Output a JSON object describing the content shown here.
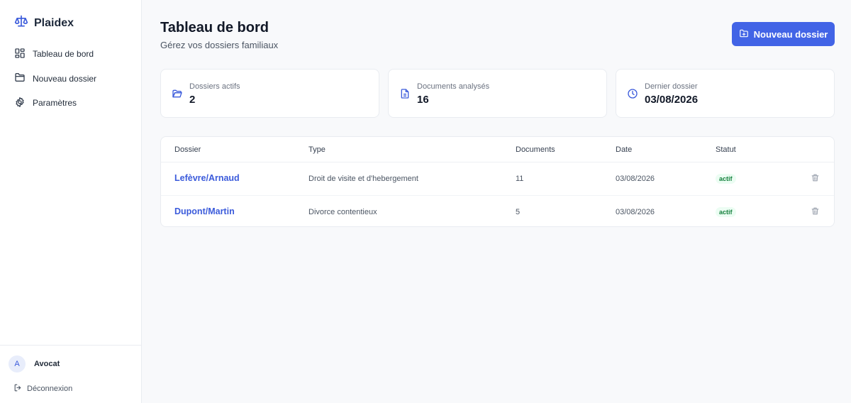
{
  "app": {
    "name": "Plaidex"
  },
  "sidebar": {
    "items": [
      {
        "label": "Tableau de bord",
        "icon": "dashboard-icon"
      },
      {
        "label": "Nouveau dossier",
        "icon": "folder-icon"
      },
      {
        "label": "Paramètres",
        "icon": "gear-icon"
      }
    ],
    "user": {
      "initial": "A",
      "name": "Avocat"
    },
    "logout_label": "Déconnexion"
  },
  "header": {
    "title": "Tableau de bord",
    "subtitle": "Gérez vos dossiers familiaux",
    "new_button_label": "Nouveau dossier"
  },
  "stats": [
    {
      "label": "Dossiers actifs",
      "value": "2",
      "icon": "folder-open-icon"
    },
    {
      "label": "Documents analysés",
      "value": "16",
      "icon": "document-icon"
    },
    {
      "label": "Dernier dossier",
      "value": "03/08/2026",
      "icon": "clock-icon"
    }
  ],
  "table": {
    "columns": [
      "Dossier",
      "Type",
      "Documents",
      "Date",
      "Statut"
    ],
    "rows": [
      {
        "dossier": "Lefèvre/Arnaud",
        "type": "Droit de visite et d'hebergement",
        "documents": "11",
        "date": "03/08/2026",
        "statut": "actif"
      },
      {
        "dossier": "Dupont/Martin",
        "type": "Divorce contentieux",
        "documents": "5",
        "date": "03/08/2026",
        "statut": "actif"
      }
    ]
  },
  "colors": {
    "accent": "#4264e6",
    "link": "#3b5bdb",
    "status_active": "#15803d"
  }
}
